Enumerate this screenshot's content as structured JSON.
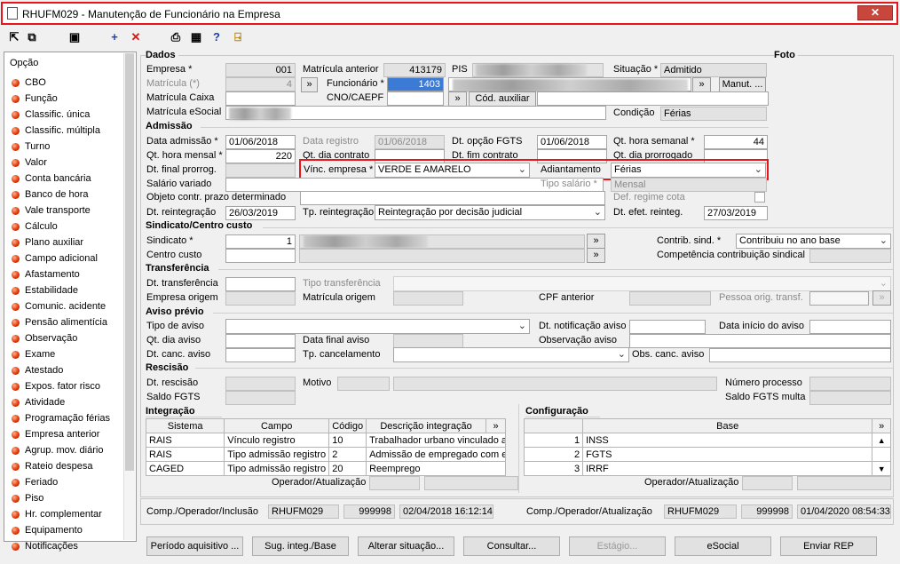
{
  "window": {
    "title": "RHUFM029 - Manutenção de Funcionário na Empresa",
    "close": "✕"
  },
  "toolbar": {
    "icons": [
      "first-icon",
      "copy-icon",
      "save-icon",
      "add-icon",
      "delete-icon",
      "print-icon",
      "calc-icon",
      "help-icon",
      "exit-icon"
    ]
  },
  "left": {
    "header": "Opção",
    "items": [
      "CBO",
      "Função",
      "Classific. única",
      "Classific. múltipla",
      "Turno",
      "Valor",
      "Conta bancária",
      "Banco de hora",
      "Vale transporte",
      "Cálculo",
      "Plano auxiliar",
      "Campo adicional",
      "Afastamento",
      "Estabilidade",
      "Comunic. acidente",
      "Pensão alimentícia",
      "Observação",
      "Exame",
      "Atestado",
      "Expos. fator risco",
      "Atividade",
      "Programação férias",
      "Empresa anterior",
      "Agrup. mov. diário",
      "Rateio despesa",
      "Feriado",
      "Piso",
      "Hr. complementar",
      "Equipamento",
      "Notificações"
    ]
  },
  "dados": {
    "title": "Dados",
    "foto": "Foto",
    "empresa_lbl": "Empresa *",
    "empresa": "001",
    "matricula_lbl": "Matrícula (*)",
    "matricula": "4",
    "mat_caixa_lbl": "Matrícula Caixa",
    "mat_esocial_lbl": "Matrícula eSocial",
    "mat_ant_lbl": "Matrícula anterior",
    "mat_ant": "413179",
    "funcionario_lbl": "Funcionário *",
    "funcionario": "1403",
    "cno_lbl": "CNO/CAEPF",
    "pis_lbl": "PIS",
    "situacao_lbl": "Situação *",
    "situacao": "Admitido",
    "manut": "Manut. ...",
    "cod_aux": "Cód. auxiliar",
    "condicao_lbl": "Condição",
    "condicao": "Férias",
    "go": "»"
  },
  "admissao": {
    "title": "Admissão",
    "dt_adm_lbl": "Data admissão *",
    "dt_adm": "01/06/2018",
    "dt_reg_lbl": "Data registro",
    "dt_reg": "01/06/2018",
    "dt_fgts_lbl": "Dt. opção FGTS",
    "dt_fgts": "01/06/2018",
    "qt_sem_lbl": "Qt. hora semanal *",
    "qt_sem": "44",
    "qt_mes_lbl": "Qt. hora mensal *",
    "qt_mes": "220",
    "dt_dia_lbl": "Qt. dia contrato",
    "dt_fim_lbl": "Dt. fim contrato",
    "qt_prorr_lbl": "Qt. dia prorrogado",
    "dt_final_lbl": "Dt. final prorrog.",
    "vinc_lbl": "Vínc. empresa *",
    "vinc": "VERDE E AMARELO",
    "adiant_lbl": "Adiantamento",
    "adiant": "Férias",
    "sal_var_lbl": "Salário variado",
    "tipo_sal_lbl": "Tipo salário *",
    "tipo_sal": "Mensal",
    "obj_lbl": "Objeto contr. prazo determinado",
    "def_lbl": "Def. regime cota",
    "dt_reint_lbl": "Dt. reintegração",
    "dt_reint": "26/03/2019",
    "tp_reint_lbl": "Tp. reintegração",
    "tp_reint": "Reintegração por decisão judicial",
    "dt_efet_lbl": "Dt. efet. reinteg.",
    "dt_efet": "27/03/2019"
  },
  "sindicato": {
    "title": "Sindicato/Centro custo",
    "sind_lbl": "Sindicato *",
    "sind": "1",
    "cc_lbl": "Centro custo",
    "contrib_lbl": "Contrib. sind. *",
    "contrib": "Contribuiu no ano base",
    "comp_lbl": "Competência contribuição sindical"
  },
  "transf": {
    "title": "Transferência",
    "dt_lbl": "Dt. transferência",
    "tipo_lbl": "Tipo transferência",
    "emp_lbl": "Empresa origem",
    "mat_lbl": "Matrícula origem",
    "cpf_lbl": "CPF anterior",
    "pess_lbl": "Pessoa orig. transf."
  },
  "aviso": {
    "title": "Aviso prévio",
    "tipo_lbl": "Tipo de aviso",
    "notif_lbl": "Dt. notificação aviso",
    "inicio_lbl": "Data início do aviso",
    "qt_lbl": "Qt. dia aviso",
    "final_lbl": "Data final aviso",
    "obs_lbl": "Observação aviso",
    "canc_lbl": "Dt. canc. aviso",
    "tpc_lbl": "Tp. cancelamento",
    "obsc_lbl": "Obs. canc. aviso"
  },
  "rescisao": {
    "title": "Rescisão",
    "dt_lbl": "Dt. rescisão",
    "motivo_lbl": "Motivo",
    "num_lbl": "Número processo",
    "saldo_lbl": "Saldo FGTS",
    "saldo_multa_lbl": "Saldo FGTS multa"
  },
  "integracao": {
    "title": "Integração",
    "cols": [
      "Sistema",
      "Campo",
      "Código",
      "Descrição integração",
      "»"
    ],
    "rows": [
      [
        "RAIS",
        "Vínculo registro",
        "10",
        "Trabalhador urbano vinculado a"
      ],
      [
        "RAIS",
        "Tipo admissão registro",
        "2",
        "Admissão de empregado com e"
      ],
      [
        "CAGED",
        "Tipo admissão registro",
        "20",
        "Reemprego"
      ]
    ],
    "op_lbl": "Operador/Atualização"
  },
  "config": {
    "title": "Configuração",
    "cols": [
      "",
      "Base",
      "»"
    ],
    "rows": [
      [
        "1",
        "INSS"
      ],
      [
        "2",
        "FGTS"
      ],
      [
        "3",
        "IRRF"
      ]
    ],
    "op_lbl": "Operador/Atualização"
  },
  "footer": {
    "inc_lbl": "Comp./Operador/Inclusão",
    "inc_prog": "RHUFM029",
    "inc_op": "999998",
    "inc_dt": "02/04/2018 16:12:14",
    "atu_lbl": "Comp./Operador/Atualização",
    "atu_prog": "RHUFM029",
    "atu_op": "999998",
    "atu_dt": "01/04/2020 08:54:33"
  },
  "buttons": [
    "Período aquisitivo ...",
    "Sug. integ./Base",
    "Alterar situação...",
    "Consultar...",
    "Estágio...",
    "eSocial",
    "Enviar REP"
  ]
}
